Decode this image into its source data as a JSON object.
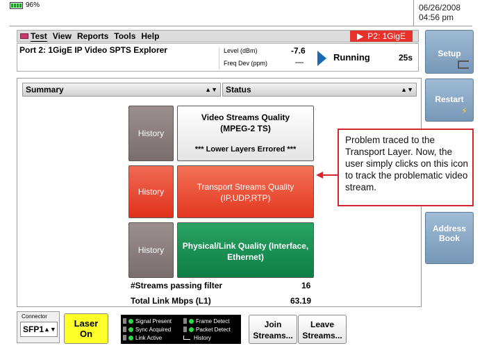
{
  "status": {
    "battery": "96%",
    "date": "06/26/2008",
    "time": "04:56 pm"
  },
  "menu": {
    "items": [
      "Test",
      "View",
      "Reports",
      "Tools",
      "Help"
    ],
    "port_badge": "P2: 1GigE"
  },
  "info": {
    "title": "Port 2: 1GigE IP Video SPTS Explorer",
    "level_label": "Level (dBm)",
    "level_value": "-7.6",
    "freq_label": "Freq Dev (ppm)",
    "freq_value": "—",
    "run_status": "Running",
    "run_time": "25s"
  },
  "side_buttons": {
    "setup": "Setup",
    "restart": "Restart",
    "address": "Address Book"
  },
  "main": {
    "summary_select": "Summary",
    "status_select": "Status",
    "history_label": "History",
    "video": {
      "title": "Video Streams Quality",
      "subtitle": "(MPEG-2 TS)",
      "error": "*** Lower Layers Errored ***"
    },
    "transport": {
      "title": "Transport Streams Quality",
      "subtitle": "(IP,UDP,RTP)"
    },
    "physical": {
      "title": "Physical/Link Quality",
      "subtitle": "(Interface, Ethernet)"
    },
    "streams_label": "#Streams passing filter",
    "streams_value": "16",
    "link_label": "Total Link Mbps (L1)",
    "link_value": "63.19"
  },
  "callout": {
    "text": "Problem traced to the Transport Layer. Now, the user simply clicks on this icon to track the problematic video stream."
  },
  "bottom": {
    "connector_label": "Connector",
    "connector_value": "SFP1",
    "laser_line1": "Laser",
    "laser_line2": "On",
    "led_signal": "Signal Present",
    "led_sync": "Sync Acquired",
    "led_link": "Link Active",
    "led_frame": "Frame Detect",
    "led_packet": "Packet Detect",
    "led_history": "History",
    "join_line1": "Join",
    "join_line2": "Streams...",
    "leave_line1": "Leave",
    "leave_line2": "Streams..."
  },
  "colors": {
    "accent_red": "#e8312a",
    "transport_red": "#e3371f",
    "physical_green": "#0e7d45",
    "history_grey": "#7a6d6d",
    "side_button_blue": "#7898b8",
    "running_blue": "#1a6bb4",
    "laser_yellow": "#ffff2a",
    "led_green": "#2bd94a"
  }
}
